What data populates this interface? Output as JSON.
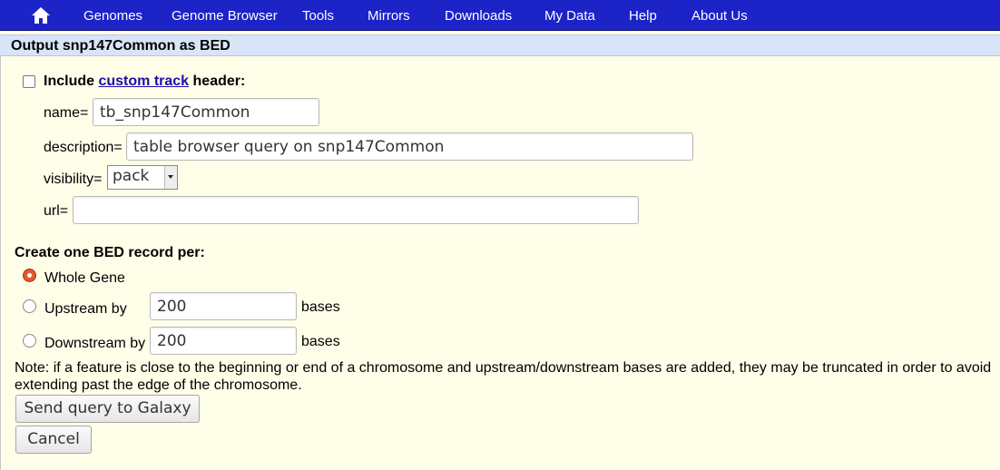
{
  "nav": {
    "home_icon": "home-icon",
    "items": [
      "Genomes",
      "Genome Browser",
      "Tools",
      "Mirrors",
      "Downloads",
      "My Data",
      "Help",
      "About Us"
    ]
  },
  "section": {
    "title": "Output snp147Common as BED"
  },
  "custom_track": {
    "label_prefix": "Include",
    "link_text": "custom track",
    "label_suffix": "header:",
    "checked": false,
    "name_label": "name=",
    "name_value": "tb_snp147Common",
    "description_label": "description=",
    "description_value": "table browser query on snp147Common",
    "visibility_label": "visibility=",
    "visibility_value": "pack",
    "url_label": "url=",
    "url_value": ""
  },
  "bed_record": {
    "heading": "Create one BED record per:",
    "options": [
      {
        "label": "Whole Gene",
        "checked": true
      },
      {
        "label": "Upstream by",
        "value": "200",
        "suffix": "bases",
        "checked": false
      },
      {
        "label": "Downstream by",
        "value": "200",
        "suffix": "bases",
        "checked": false
      }
    ]
  },
  "note": "Note: if a feature is close to the beginning or end of a chromosome and upstream/downstream bases are added, they may be truncated in order to avoid extending past the edge of the chromosome.",
  "buttons": {
    "send": "Send query to Galaxy",
    "cancel": "Cancel"
  },
  "colors": {
    "nav_bg": "#1c23c7",
    "page_bg": "#fffee8",
    "header_bg": "#d8e4f8",
    "radio_checked": "#e05a2a"
  }
}
